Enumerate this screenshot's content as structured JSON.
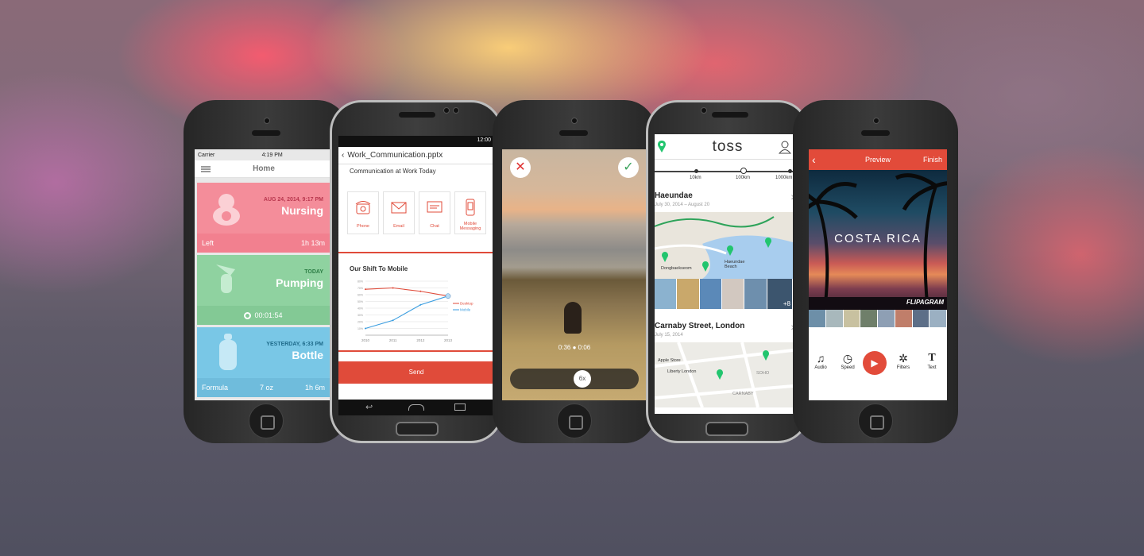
{
  "colors": {
    "accent": "#e04b3a",
    "nursing": "#f48d9a",
    "pumping": "#8fd2a0",
    "bottle": "#79c7e6",
    "map_pin": "#22c56e"
  },
  "phone1": {
    "status": {
      "carrier": "Carrier",
      "time": "4:19 PM"
    },
    "title": "Home",
    "cards": [
      {
        "date": "AUG 24, 2014, 9:17 PM",
        "title": "Nursing",
        "left": "Left",
        "right": "1h 13m"
      },
      {
        "date": "TODAY",
        "title": "Pumping",
        "timer": "00:01:54"
      },
      {
        "date": "YESTERDAY, 6:33 PM",
        "title": "Bottle",
        "left": "Formula",
        "mid": "7 oz",
        "right": "1h 6m"
      }
    ]
  },
  "phone2": {
    "status_time": "12:00",
    "file": "Work_Communication.pptx",
    "subtitle": "Communication at Work Today",
    "tiles": [
      "Phone",
      "Email",
      "Chat",
      "Mobile Messaging"
    ],
    "chart_title": "Our Shift To Mobile",
    "send": "Send",
    "chart_data": {
      "type": "line",
      "x": [
        "2010",
        "2011",
        "2012",
        "2013"
      ],
      "yticks": [
        "80%",
        "70%",
        "60%",
        "50%",
        "40%",
        "30%",
        "20%",
        "10%"
      ],
      "ylim": [
        0,
        80
      ],
      "series": [
        {
          "name": "Desktop",
          "values": [
            68,
            70,
            65,
            58
          ],
          "color": "#e04b3a"
        },
        {
          "name": "Mobile",
          "values": [
            10,
            22,
            45,
            58
          ],
          "color": "#3a9de0"
        }
      ]
    }
  },
  "phone3": {
    "time_left": "0:36",
    "time_right": "0:06",
    "speed": "6x"
  },
  "phone4": {
    "logo": "toss",
    "distances": [
      "10km",
      "100km",
      "1000km"
    ],
    "places": [
      {
        "name": "Haeundae",
        "date": "July 30, 2014 – August 20",
        "more": "+8"
      },
      {
        "name": "Carnaby Street, London",
        "date": "July 15, 2014"
      }
    ],
    "map1_labels": [
      "Dongbaekseom",
      "Haeundae Beach"
    ],
    "map2_labels": [
      "Apple Store",
      "Liberty London",
      "SOHO",
      "CARNABY"
    ]
  },
  "phone5": {
    "title": "Preview",
    "finish": "Finish",
    "caption": "COSTA RICA",
    "brand": "FLIPAGRAM",
    "tools": [
      "Audio",
      "Speed",
      "Filters",
      "Text"
    ]
  }
}
